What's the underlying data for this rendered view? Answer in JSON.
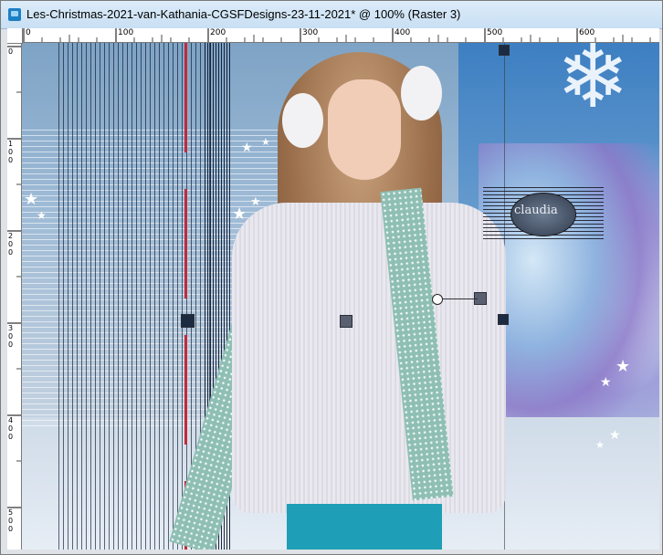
{
  "window": {
    "title": "Les-Christmas-2021-van-Kathania-CGSFDesigns-23-11-2021* @ 100% (Raster 3)",
    "icon": "image-document-icon"
  },
  "rulers": {
    "horizontal_labels": [
      "0",
      "100",
      "200",
      "300",
      "400",
      "500",
      "600"
    ],
    "vertical_labels": [
      "0",
      "100",
      "200",
      "300",
      "400",
      "500"
    ]
  },
  "canvas": {
    "watermark_text": "claudia",
    "colors": {
      "guide_red": "#c22a3a",
      "pants": "#1e9fb7",
      "scarf": "#8fbfb4"
    }
  }
}
